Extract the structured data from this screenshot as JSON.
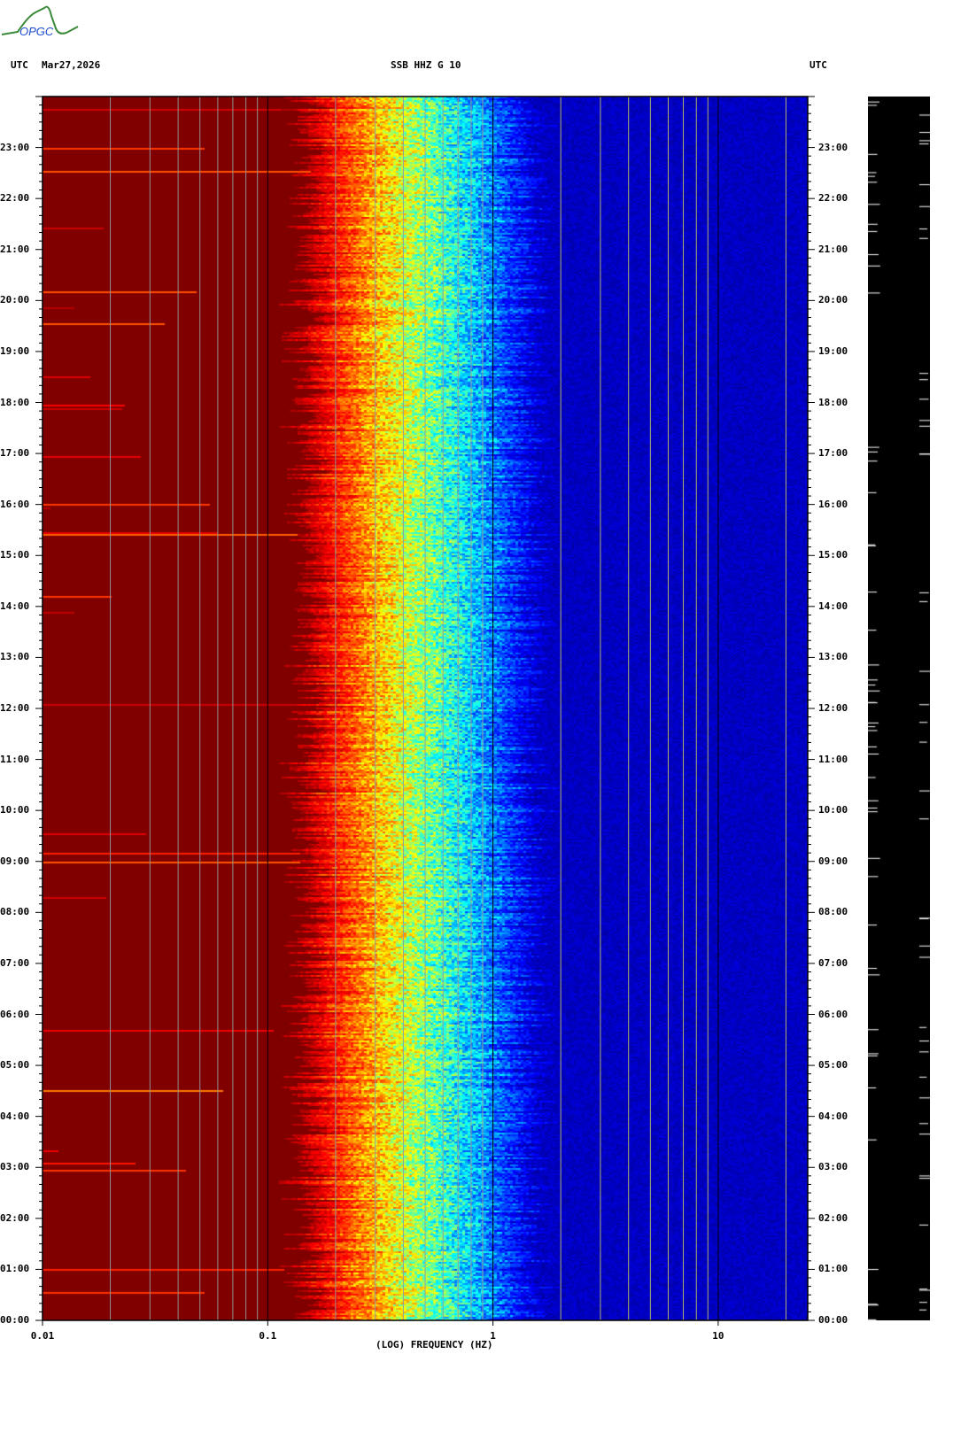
{
  "logo": {
    "text": "OPGC"
  },
  "header": {
    "left_tz": "UTC",
    "date": "Mar27,2026",
    "title": "SSB HHZ G 10",
    "right_tz": "UTC"
  },
  "colors": {
    "low": "#800000",
    "high": "#0000b0",
    "strip": "#000000"
  },
  "chart_data": {
    "type": "heatmap",
    "title": "SSB HHZ G 10",
    "xlabel": "(LOG) FREQUENCY (HZ)",
    "ylabel": "UTC",
    "xscale": "log",
    "xlim": [
      0.01,
      25
    ],
    "ylim_hours": [
      0,
      24
    ],
    "x_ticks": [
      {
        "value": 0.01,
        "label": "0.01"
      },
      {
        "value": 0.1,
        "label": "0.1"
      },
      {
        "value": 1,
        "label": "1"
      },
      {
        "value": 10,
        "label": "10"
      }
    ],
    "y_ticks": [
      "00:00",
      "01:00",
      "02:00",
      "03:00",
      "04:00",
      "05:00",
      "06:00",
      "07:00",
      "08:00",
      "09:00",
      "10:00",
      "11:00",
      "12:00",
      "13:00",
      "14:00",
      "15:00",
      "16:00",
      "17:00",
      "18:00",
      "19:00",
      "20:00",
      "21:00",
      "22:00",
      "23:00"
    ],
    "colormap": "jet",
    "description_values": {
      "energy_transition_hz": [
        0.3,
        0.9
      ],
      "peak_hz": 0.5
    }
  }
}
